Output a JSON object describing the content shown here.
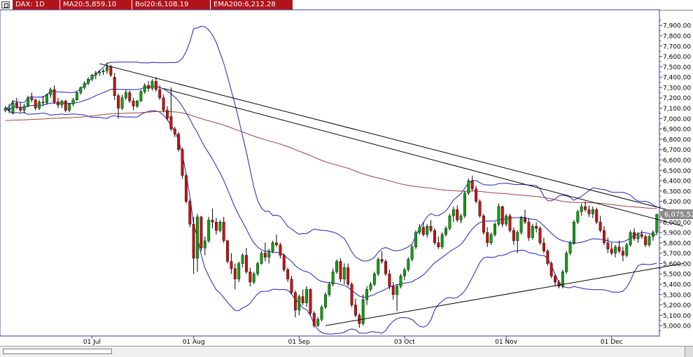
{
  "header": {
    "symbol": "DAX: 1D",
    "ma20": "MA20:5,859.10",
    "bol20": "Bol20:6,108.19",
    "ema200": "EMA200:6,212.28"
  },
  "colors": {
    "up": "#10a010",
    "down": "#cc1010",
    "band": "#2020c0",
    "ema": "#a04040",
    "trend": "#000000",
    "header_bg": "#b0141a",
    "axis": "#3a3aa0"
  },
  "chart_data": {
    "type": "candlestick",
    "ylim": [
      4900,
      8050
    ],
    "y_ticks": [
      5000,
      5100,
      5200,
      5300,
      5400,
      5500,
      5600,
      5700,
      5800,
      5900,
      6000,
      6100,
      6200,
      6300,
      6400,
      6500,
      6600,
      6700,
      6800,
      6900,
      7000,
      7100,
      7200,
      7300,
      7400,
      7500,
      7600,
      7700,
      7800,
      7900
    ],
    "y_tick_labels": [
      "5,000.00",
      "5,100.00",
      "5,200.00",
      "5,300.00",
      "5,400.00",
      "5,500.00",
      "5,600.00",
      "5,700.00",
      "5,800.00",
      "5,900.00",
      "6,000.00",
      "6,100.00",
      "6,200.00",
      "6,300.00",
      "6,400.00",
      "6,500.00",
      "6,600.00",
      "6,700.00",
      "6,800.00",
      "6,900.00",
      "7,000.00",
      "7,100.00",
      "7,200.00",
      "7,300.00",
      "7,400.00",
      "7,500.00",
      "7,600.00",
      "7,700.00",
      "7,800.00",
      "7,900.00"
    ],
    "x_ticks": [
      {
        "index": 23,
        "label": "01 Jul"
      },
      {
        "index": 50,
        "label": "01 Aug"
      },
      {
        "index": 78,
        "label": "01 Sep"
      },
      {
        "index": 106,
        "label": "03 Oct"
      },
      {
        "index": 133,
        "label": "01 Nov"
      },
      {
        "index": 161,
        "label": "01 Dec"
      }
    ],
    "last_price_label": "6,075.52",
    "last_price": 6075.52,
    "candles": [
      [
        7080,
        7120,
        7060,
        7100
      ],
      [
        7090,
        7140,
        7050,
        7080
      ],
      [
        7060,
        7180,
        7040,
        7150
      ],
      [
        7150,
        7200,
        7090,
        7110
      ],
      [
        7110,
        7160,
        7060,
        7080
      ],
      [
        7080,
        7140,
        7050,
        7120
      ],
      [
        7120,
        7220,
        7110,
        7200
      ],
      [
        7200,
        7250,
        7160,
        7180
      ],
      [
        7180,
        7190,
        7080,
        7100
      ],
      [
        7100,
        7180,
        7080,
        7160
      ],
      [
        7160,
        7220,
        7120,
        7150
      ],
      [
        7150,
        7240,
        7140,
        7230
      ],
      [
        7230,
        7300,
        7200,
        7280
      ],
      [
        7280,
        7320,
        7140,
        7160
      ],
      [
        7160,
        7200,
        7100,
        7130
      ],
      [
        7130,
        7180,
        7100,
        7170
      ],
      [
        7170,
        7180,
        7060,
        7080
      ],
      [
        7080,
        7150,
        7060,
        7140
      ],
      [
        7140,
        7200,
        7120,
        7180
      ],
      [
        7180,
        7260,
        7170,
        7250
      ],
      [
        7250,
        7310,
        7230,
        7300
      ],
      [
        7300,
        7360,
        7280,
        7340
      ],
      [
        7340,
        7400,
        7320,
        7380
      ],
      [
        7380,
        7430,
        7360,
        7420
      ],
      [
        7420,
        7460,
        7380,
        7440
      ],
      [
        7440,
        7470,
        7410,
        7450
      ],
      [
        7450,
        7480,
        7420,
        7460
      ],
      [
        7460,
        7540,
        7430,
        7500
      ],
      [
        7500,
        7520,
        7400,
        7420
      ],
      [
        7400,
        7440,
        7180,
        7220
      ],
      [
        7220,
        7240,
        7000,
        7100
      ],
      [
        7100,
        7230,
        7080,
        7200
      ],
      [
        7200,
        7280,
        7180,
        7250
      ],
      [
        7250,
        7270,
        7150,
        7170
      ],
      [
        7170,
        7200,
        7080,
        7120
      ],
      [
        7120,
        7180,
        7100,
        7170
      ],
      [
        7170,
        7280,
        7160,
        7260
      ],
      [
        7260,
        7340,
        7240,
        7320
      ],
      [
        7320,
        7360,
        7260,
        7290
      ],
      [
        7290,
        7380,
        7270,
        7360
      ],
      [
        7360,
        7400,
        7260,
        7280
      ],
      [
        7280,
        7320,
        7180,
        7200
      ],
      [
        7200,
        7230,
        7060,
        7080
      ],
      [
        7080,
        7120,
        6980,
        7000
      ],
      [
        7020,
        7300,
        6880,
        6900
      ],
      [
        6900,
        6920,
        6820,
        6850
      ],
      [
        6850,
        6870,
        6680,
        6700
      ],
      [
        6700,
        6720,
        6420,
        6450
      ],
      [
        6450,
        6470,
        6180,
        6200
      ],
      [
        6200,
        6220,
        5950,
        5980
      ],
      [
        5980,
        6050,
        5500,
        5650
      ],
      [
        5650,
        6080,
        5520,
        6050
      ],
      [
        6050,
        6060,
        5720,
        5750
      ],
      [
        5750,
        5860,
        5680,
        5820
      ],
      [
        5820,
        6050,
        5800,
        6020
      ],
      [
        6020,
        6130,
        5940,
        6000
      ],
      [
        6000,
        6040,
        5880,
        5920
      ],
      [
        5920,
        6020,
        5900,
        6000
      ],
      [
        6000,
        6050,
        5800,
        5820
      ],
      [
        5820,
        5830,
        5600,
        5620
      ],
      [
        5620,
        5700,
        5500,
        5550
      ],
      [
        5550,
        5600,
        5350,
        5450
      ],
      [
        5450,
        5620,
        5420,
        5600
      ],
      [
        5600,
        5700,
        5560,
        5680
      ],
      [
        5680,
        5750,
        5500,
        5520
      ],
      [
        5520,
        5560,
        5380,
        5420
      ],
      [
        5420,
        5520,
        5400,
        5500
      ],
      [
        5500,
        5620,
        5480,
        5600
      ],
      [
        5600,
        5720,
        5590,
        5700
      ],
      [
        5700,
        5800,
        5620,
        5660
      ],
      [
        5660,
        5740,
        5600,
        5720
      ],
      [
        5720,
        5820,
        5700,
        5800
      ],
      [
        5800,
        5880,
        5760,
        5780
      ],
      [
        5780,
        5800,
        5650,
        5680
      ],
      [
        5680,
        5700,
        5520,
        5540
      ],
      [
        5540,
        5560,
        5420,
        5450
      ],
      [
        5450,
        5480,
        5300,
        5320
      ],
      [
        5320,
        5340,
        5080,
        5150
      ],
      [
        5150,
        5300,
        5100,
        5280
      ],
      [
        5280,
        5350,
        5200,
        5220
      ],
      [
        5220,
        5380,
        5180,
        5350
      ],
      [
        5350,
        5360,
        5100,
        5120
      ],
      [
        5120,
        5140,
        4980,
        5000
      ],
      [
        5000,
        5080,
        4990,
        5060
      ],
      [
        5060,
        5200,
        5040,
        5180
      ],
      [
        5180,
        5320,
        5160,
        5300
      ],
      [
        5300,
        5420,
        5280,
        5400
      ],
      [
        5400,
        5550,
        5380,
        5520
      ],
      [
        5520,
        5640,
        5500,
        5620
      ],
      [
        5620,
        5650,
        5420,
        5450
      ],
      [
        5450,
        5600,
        5400,
        5560
      ],
      [
        5560,
        5600,
        5380,
        5400
      ],
      [
        5400,
        5420,
        5180,
        5200
      ],
      [
        5200,
        5260,
        5080,
        5100
      ],
      [
        5100,
        5120,
        4980,
        5020
      ],
      [
        5020,
        5300,
        5000,
        5250
      ],
      [
        5250,
        5380,
        5200,
        5350
      ],
      [
        5350,
        5420,
        5330,
        5400
      ],
      [
        5400,
        5520,
        5380,
        5500
      ],
      [
        5500,
        5660,
        5480,
        5640
      ],
      [
        5640,
        5720,
        5600,
        5620
      ],
      [
        5620,
        5640,
        5480,
        5500
      ],
      [
        5500,
        5540,
        5350,
        5380
      ],
      [
        5380,
        5420,
        5250,
        5300
      ],
      [
        5300,
        5400,
        5140,
        5380
      ],
      [
        5380,
        5500,
        5360,
        5480
      ],
      [
        5480,
        5560,
        5440,
        5540
      ],
      [
        5540,
        5660,
        5520,
        5640
      ],
      [
        5640,
        5780,
        5620,
        5760
      ],
      [
        5760,
        5920,
        5740,
        5900
      ],
      [
        5900,
        5980,
        5880,
        5950
      ],
      [
        5950,
        6000,
        5860,
        5880
      ],
      [
        5880,
        5980,
        5850,
        5960
      ],
      [
        5960,
        6020,
        5900,
        5920
      ],
      [
        5920,
        5940,
        5780,
        5800
      ],
      [
        5800,
        5860,
        5740,
        5760
      ],
      [
        5760,
        5900,
        5740,
        5880
      ],
      [
        5880,
        5960,
        5860,
        5940
      ],
      [
        5940,
        6080,
        5920,
        6060
      ],
      [
        6060,
        6150,
        6000,
        6120
      ],
      [
        6120,
        6160,
        6000,
        6020
      ],
      [
        6020,
        6080,
        5990,
        6060
      ],
      [
        6060,
        6300,
        6040,
        6280
      ],
      [
        6280,
        6420,
        6260,
        6400
      ],
      [
        6400,
        6450,
        6300,
        6320
      ],
      [
        6320,
        6350,
        6180,
        6200
      ],
      [
        6200,
        6220,
        6040,
        6060
      ],
      [
        6060,
        6080,
        5880,
        5900
      ],
      [
        5900,
        5950,
        5760,
        5800
      ],
      [
        5800,
        5900,
        5780,
        5880
      ],
      [
        5880,
        6000,
        5860,
        5980
      ],
      [
        5980,
        6180,
        5960,
        6150
      ],
      [
        6150,
        6160,
        5950,
        5980
      ],
      [
        5980,
        6080,
        5960,
        6060
      ],
      [
        6060,
        6080,
        5900,
        5920
      ],
      [
        5920,
        5950,
        5780,
        5820
      ],
      [
        5820,
        5920,
        5700,
        5900
      ],
      [
        5900,
        6060,
        5880,
        6040
      ],
      [
        6040,
        6120,
        5980,
        6000
      ],
      [
        6000,
        6040,
        5820,
        5850
      ],
      [
        5850,
        5980,
        5830,
        5960
      ],
      [
        5960,
        6000,
        5900,
        5940
      ],
      [
        5940,
        5960,
        5780,
        5800
      ],
      [
        5800,
        5850,
        5700,
        5720
      ],
      [
        5720,
        5740,
        5580,
        5600
      ],
      [
        5600,
        5620,
        5460,
        5480
      ],
      [
        5480,
        5500,
        5380,
        5420
      ],
      [
        5420,
        5440,
        5360,
        5380
      ],
      [
        5380,
        5540,
        5360,
        5520
      ],
      [
        5520,
        5720,
        5500,
        5700
      ],
      [
        5700,
        5820,
        5680,
        5800
      ],
      [
        5800,
        6020,
        5780,
        6000
      ],
      [
        6000,
        6120,
        5980,
        6100
      ],
      [
        6100,
        6180,
        6060,
        6150
      ],
      [
        6150,
        6200,
        6100,
        6120
      ],
      [
        6120,
        6160,
        6050,
        6080
      ],
      [
        6080,
        6150,
        6040,
        6120
      ],
      [
        6120,
        6140,
        5980,
        6000
      ],
      [
        6000,
        6060,
        5900,
        5920
      ],
      [
        5920,
        5960,
        5780,
        5800
      ],
      [
        5800,
        5850,
        5700,
        5740
      ],
      [
        5740,
        5800,
        5680,
        5700
      ],
      [
        5700,
        5780,
        5660,
        5760
      ],
      [
        5760,
        5820,
        5700,
        5720
      ],
      [
        5720,
        5760,
        5620,
        5680
      ],
      [
        5680,
        5800,
        5660,
        5780
      ],
      [
        5780,
        5920,
        5760,
        5900
      ],
      [
        5900,
        5940,
        5820,
        5840
      ],
      [
        5840,
        5900,
        5800,
        5880
      ],
      [
        5880,
        5920,
        5840,
        5860
      ],
      [
        5860,
        5880,
        5760,
        5780
      ],
      [
        5780,
        5880,
        5760,
        5860
      ],
      [
        5860,
        5920,
        5820,
        5900
      ],
      [
        5900,
        6080,
        5880,
        6075.52
      ]
    ],
    "trendlines": [
      {
        "x1": 25,
        "y1": 7530,
        "x2": 180,
        "y2": 6080
      },
      {
        "x1": 42,
        "y1": 7290,
        "x2": 180,
        "y2": 5960
      },
      {
        "x1": 85,
        "y1": 5000,
        "x2": 180,
        "y2": 5600
      }
    ]
  }
}
